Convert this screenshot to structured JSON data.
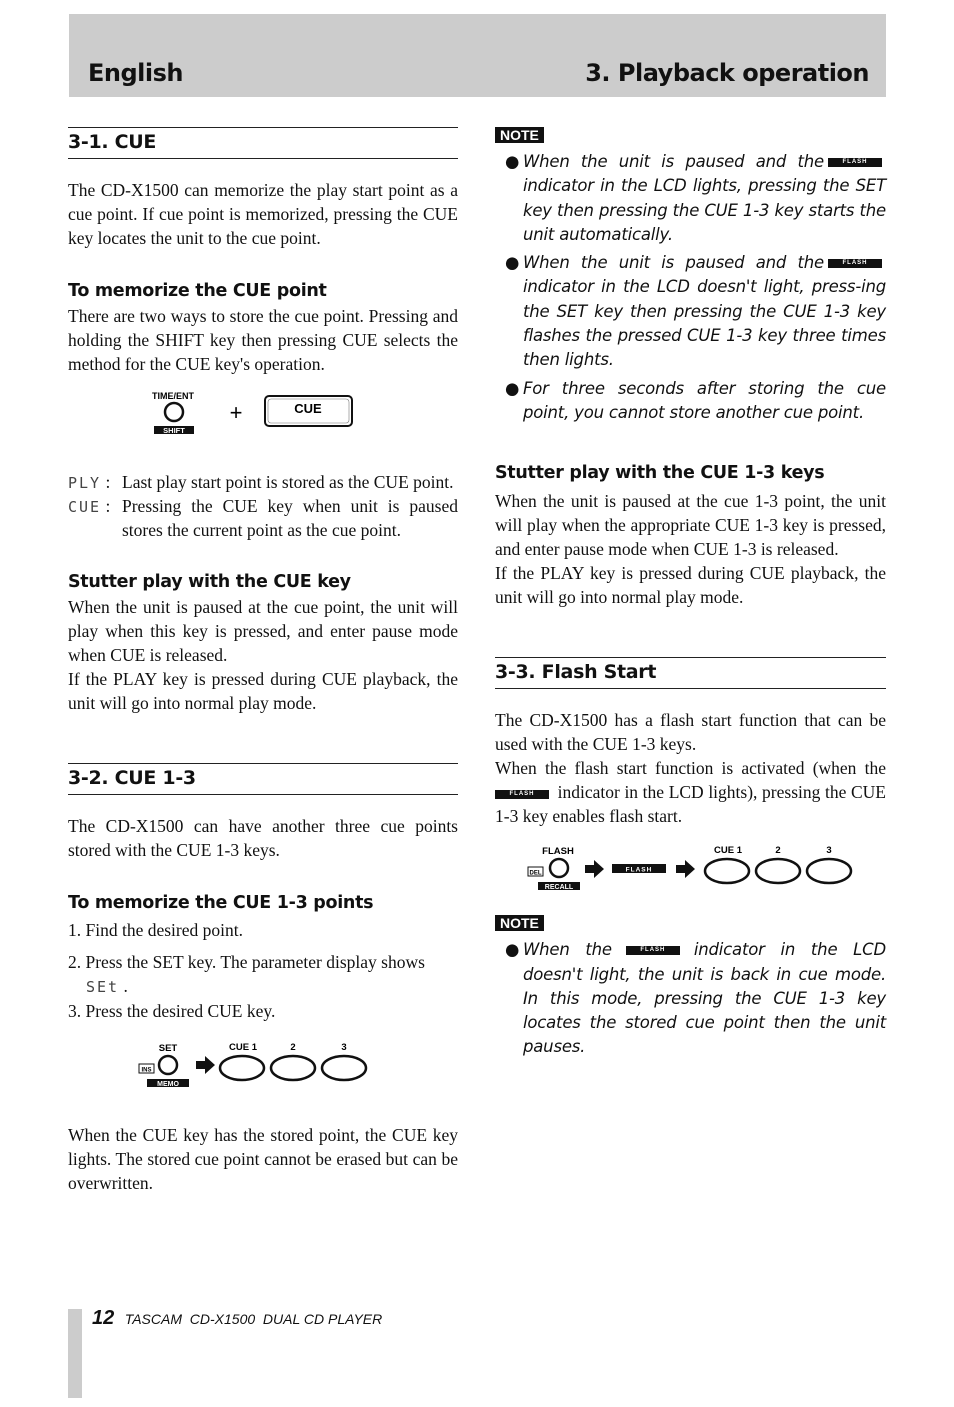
{
  "header": {
    "left": "English",
    "right": "3. Playback operation"
  },
  "left_column": {
    "cue": {
      "title": "3-1. CUE",
      "intro": "The CD-X1500 can memorize the play start point as a cue point.  If cue point is memorized, pressing the CUE key locates the unit to the cue point.",
      "memorize_title": "To memorize the CUE point",
      "memorize_text": "There are two ways to store the cue point. Pressing and holding the SHIFT key then pressing CUE selects the method for the CUE key's operation.",
      "diagram": {
        "top_label": "TIME/ENT",
        "bottom_label": "SHIFT",
        "plus": "+",
        "key_label": "CUE"
      },
      "definitions": [
        {
          "lcd": "PLY",
          "text": "Last play start point is stored as the CUE point."
        },
        {
          "lcd": "CUE",
          "text": "Pressing the CUE key when unit is paused stores the current point as the cue point."
        }
      ],
      "stutter_title": "Stutter play with the CUE key",
      "stutter_text": "When the unit is paused at the cue point, the unit will play when this key is pressed, and enter pause mode when CUE is released.",
      "stutter_text2": "If the PLAY key is pressed during CUE playback, the unit will go into normal play mode."
    },
    "cue13": {
      "title": "3-2. CUE 1-3",
      "intro": "The CD-X1500 can have another three cue points stored with the CUE 1-3 keys.",
      "memorize_title": "To memorize the CUE 1-3 points",
      "steps": [
        "1. Find the desired point.",
        "2. Press the SET key.  The parameter display shows",
        "3. Press the desired CUE key."
      ],
      "step2_lcd": "SEt",
      "diagram": {
        "set_label": "SET",
        "ins_label": "INS",
        "memo_label": "MEMO",
        "cue1_label": "CUE 1",
        "cue2_label": "2",
        "cue3_label": "3"
      },
      "outro": "When the CUE key has the stored point, the CUE key lights.  The stored cue point cannot be erased but can be overwritten."
    }
  },
  "right_column": {
    "note1": {
      "label": "NOTE",
      "flash_tag": "FLASH",
      "items": [
        {
          "before": "When the unit is paused and the",
          "after": "indicator in the LCD lights, pressing the SET key then pressing the CUE 1-3 key starts the unit automatically."
        },
        {
          "before": "When the unit is paused and the",
          "after": "indicator in the LCD doesn't light, press-ing the SET key then pressing the CUE 1-3 key flashes the pressed CUE 1-3 key three times then lights."
        },
        {
          "text": "For three seconds after storing the cue point, you cannot store another cue point."
        }
      ]
    },
    "stutter13": {
      "title": "Stutter play with the CUE 1-3 keys",
      "text": "When the unit is paused at the cue 1-3 point, the unit will play when the appropriate CUE 1-3 key is pressed, and enter pause mode when CUE 1-3 is released.",
      "text2": "If the PLAY key is pressed during CUE playback, the unit will go into normal play mode."
    },
    "flash": {
      "title": "3-3. Flash Start",
      "intro": "The CD-X1500 has a flash start function that can be used with the CUE 1-3 keys.",
      "text_before": "When the flash start function is activated (when the",
      "text_after": "indicator in the LCD lights), pressing the CUE 1-3 key enables flash start.",
      "flash_tag": "FLASH",
      "diagram": {
        "flash_label": "FLASH",
        "del_label": "DEL",
        "recall_label": "RECALL",
        "indicator_label": "FLASH",
        "cue1_label": "CUE 1",
        "cue2_label": "2",
        "cue3_label": "3"
      }
    },
    "note2": {
      "label": "NOTE",
      "flash_tag": "FLASH",
      "before": "When the",
      "after": "indicator in the LCD doesn't light, the unit is back in cue mode.  In this mode, pressing the CUE 1-3 key locates the stored cue point then the unit pauses."
    }
  },
  "footer": {
    "page_number": "12",
    "title": "TASCAM  CD-X1500  DUAL CD PLAYER"
  }
}
